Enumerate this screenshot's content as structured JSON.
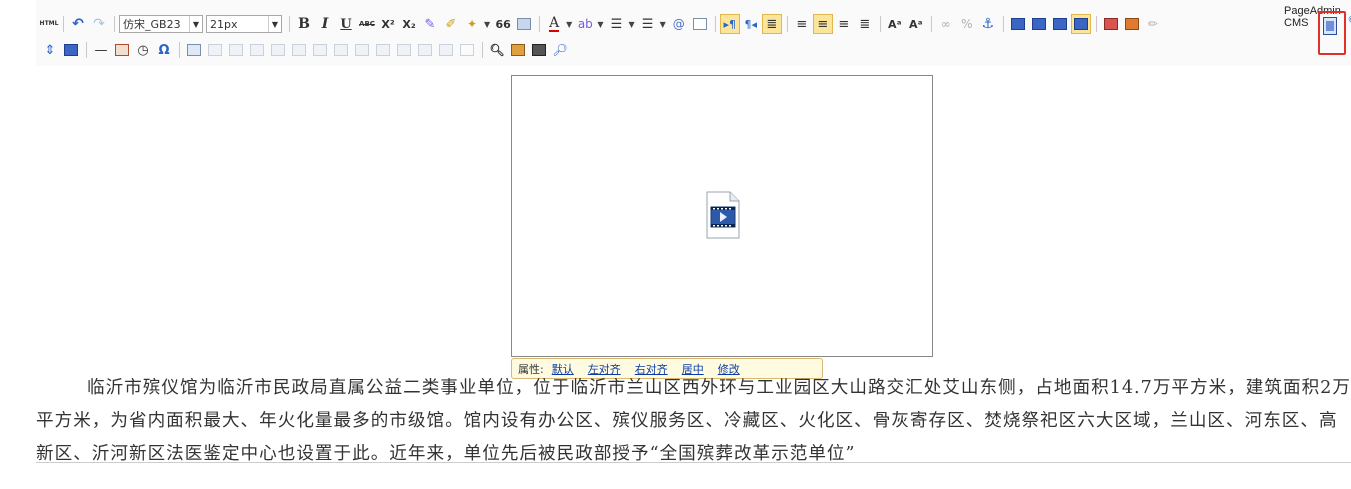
{
  "toolbar": {
    "html_label": "HTML",
    "font_family": "仿宋_GB23",
    "font_size": "21px",
    "bold_glyph": "B",
    "italic_glyph": "I",
    "underline_glyph": "U",
    "strike_glyph": "ABC",
    "superscript_glyph": "X²",
    "subscript_glyph": "X₂",
    "blockquote_glyph": "66",
    "forecolor_glyph": "A",
    "omega_glyph": "Ω",
    "brand": "PageAdmin CMS",
    "highlight_color": "#e0302a"
  },
  "video": {
    "icon": "video-file-icon"
  },
  "image_popup": {
    "prefix": "属性:",
    "links": [
      "默认",
      "左对齐",
      "右对齐",
      "居中",
      "修改"
    ]
  },
  "content": {
    "paragraph": "临沂市殡仪馆为临沂市民政局直属公益二类事业单位，位于临沂市兰山区西外环与工业园区大山路交汇处艾山东侧，占地面积14.7万平方米，建筑面积2万平方米，为省内面积最大、年火化量最多的市级馆。馆内设有办公区、殡仪服务区、冷藏区、火化区、骨灰寄存区、焚烧祭祀区六大区域，兰山区、河东区、高新区、沂河新区法医鉴定中心也设置于此。近年来，单位先后被民政部授予“全国殡葬改革示范单位”"
  }
}
